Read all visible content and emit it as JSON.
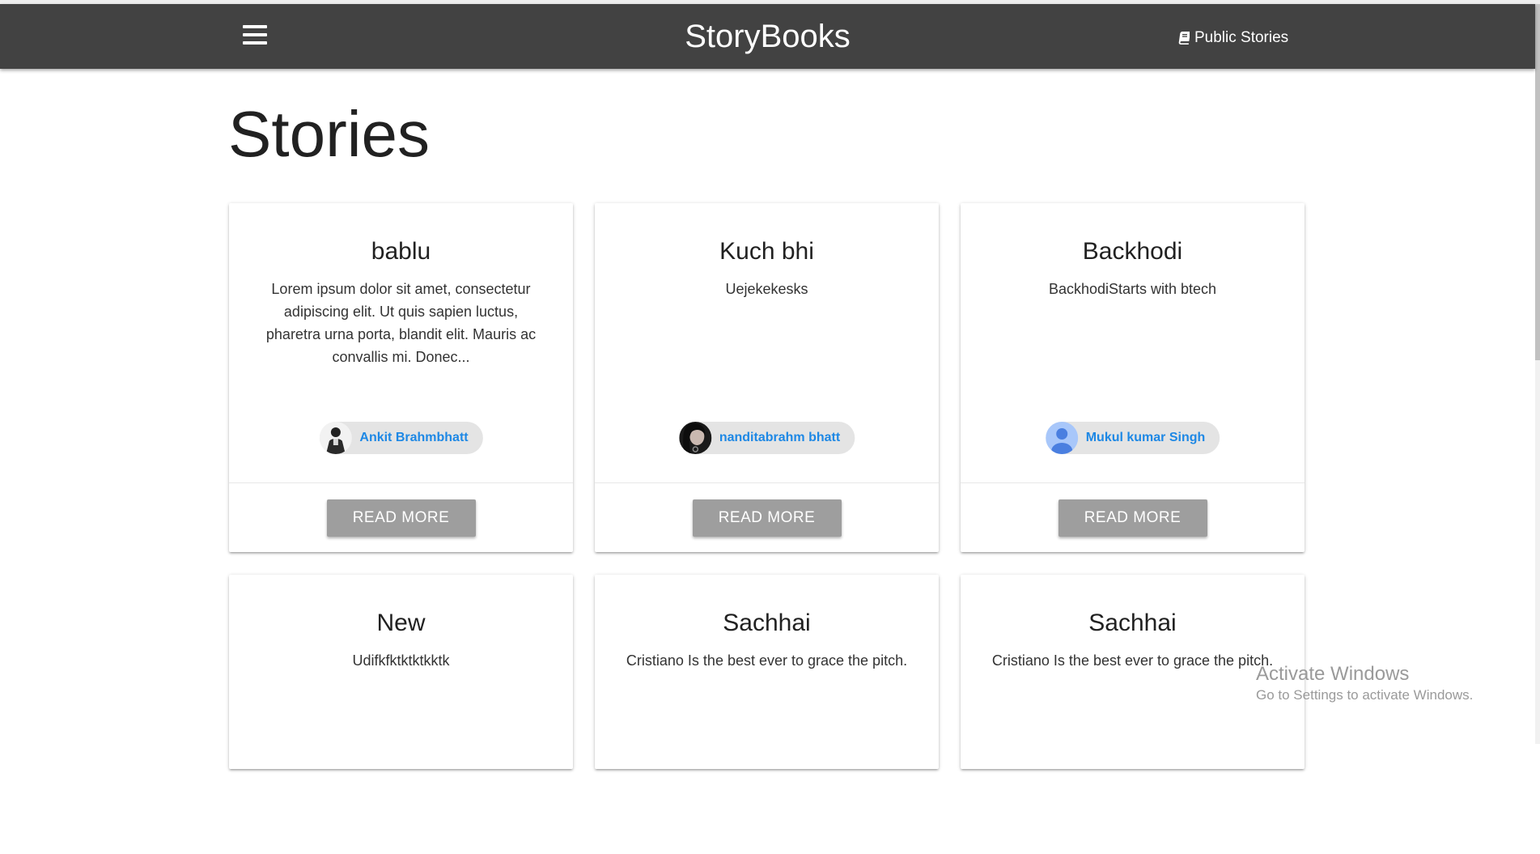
{
  "app": {
    "brand": "StoryBooks",
    "nav_link": "Public Stories",
    "menu_icon": "hamburger-menu-icon",
    "nav_link_icon": "book-icon"
  },
  "page": {
    "title": "Stories"
  },
  "stories": [
    {
      "title": "bablu",
      "body": "Lorem ipsum dolor sit amet, consectetur adipiscing elit. Ut quis sapien luctus, pharetra urna porta, blandit elit. Mauris ac convallis mi. Donec...",
      "author": "Ankit Brahmbhatt",
      "button": "READ MORE"
    },
    {
      "title": "Kuch bhi",
      "body": "Uejekekesks",
      "author": "nanditabrahm bhatt",
      "button": "READ MORE"
    },
    {
      "title": "Backhodi",
      "body": "BackhodiStarts with btech",
      "author": "Mukul kumar Singh",
      "button": "READ MORE"
    },
    {
      "title": "New",
      "body": "Udifkfktktktkktk"
    },
    {
      "title": "Sachhai",
      "body": "Cristiano Is the best ever to grace the pitch."
    },
    {
      "title": "Sachhai",
      "body": "Cristiano Is the best ever to grace the pitch."
    }
  ],
  "watermark": {
    "title": "Activate Windows",
    "subtitle": "Go to Settings to activate Windows."
  },
  "colors": {
    "navbar": "#424242",
    "author_link": "#1e88e5",
    "button": "#9e9e9e",
    "chip": "#e4e4e4"
  }
}
